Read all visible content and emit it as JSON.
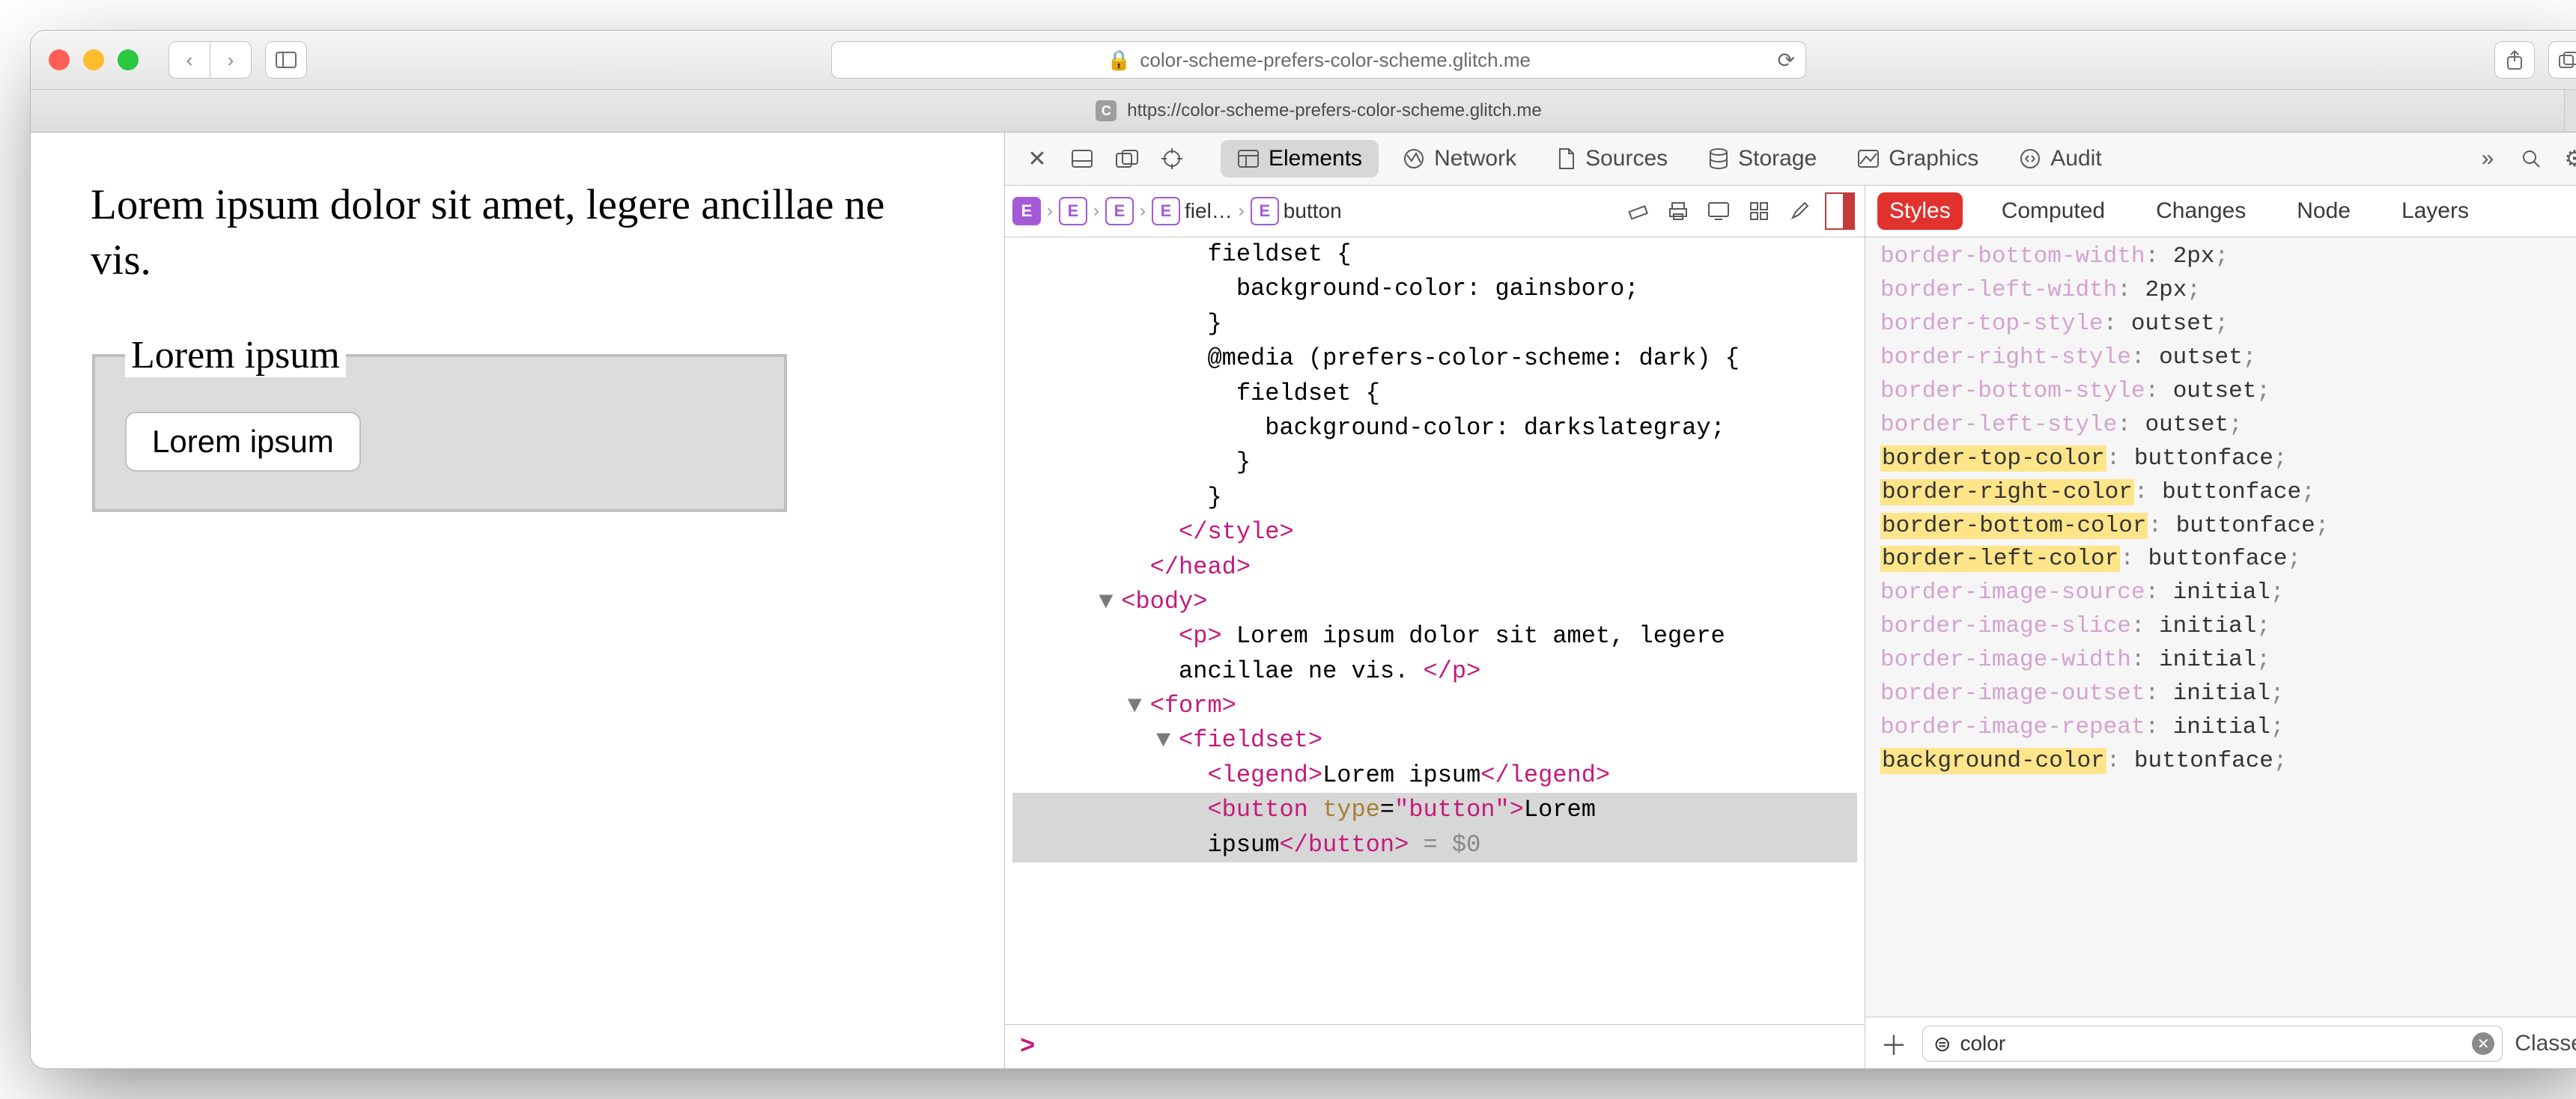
{
  "urlbar": "color-scheme-prefers-color-scheme.glitch.me",
  "tab_url": "https://color-scheme-prefers-color-scheme.glitch.me",
  "tab_icon_letter": "C",
  "page": {
    "paragraph": "Lorem ipsum dolor sit amet, legere ancillae ne vis.",
    "legend": "Lorem ipsum",
    "button": "Lorem ipsum"
  },
  "devtools": {
    "tabs": [
      "Elements",
      "Network",
      "Sources",
      "Storage",
      "Graphics",
      "Audit"
    ],
    "active_tab": "Elements",
    "breadcrumb_labels": [
      "",
      "",
      "",
      "fiel…",
      "button"
    ],
    "console_prompt": ">",
    "style_tabs": [
      "Styles",
      "Computed",
      "Changes",
      "Node",
      "Layers"
    ],
    "active_style_tab": "Styles",
    "filter_value": "color",
    "classes_label": "Classes",
    "dom_lines": [
      {
        "indent": 14,
        "html": "fieldset {"
      },
      {
        "indent": 16,
        "html": "background-color: gainsboro;"
      },
      {
        "indent": 14,
        "html": "}"
      },
      {
        "indent": 14,
        "html": "@media (prefers-color-scheme: dark) {"
      },
      {
        "indent": 16,
        "html": "fieldset {"
      },
      {
        "indent": 18,
        "html": "background-color: darkslategray;"
      },
      {
        "indent": 16,
        "html": "}"
      },
      {
        "indent": 14,
        "html": "}"
      },
      {
        "indent": 12,
        "html": "<span class='tag'>&lt;/style&gt;</span>"
      },
      {
        "indent": 10,
        "html": "<span class='tag'>&lt;/head&gt;</span>"
      },
      {
        "indent": 8,
        "tri": "▼",
        "html": "<span class='tag'>&lt;body&gt;</span>"
      },
      {
        "indent": 12,
        "html": "<span class='tag'>&lt;p&gt;</span> Lorem ipsum dolor sit amet, legere"
      },
      {
        "indent": 12,
        "html": "ancillae ne vis. <span class='tag'>&lt;/p&gt;</span>"
      },
      {
        "indent": 10,
        "tri": "▼",
        "html": "<span class='tag'>&lt;form&gt;</span>"
      },
      {
        "indent": 12,
        "tri": "▼",
        "html": "<span class='tag'>&lt;fieldset&gt;</span>"
      },
      {
        "indent": 14,
        "html": "<span class='tag'>&lt;legend&gt;</span>Lorem ipsum<span class='tag'>&lt;/legend&gt;</span>"
      },
      {
        "indent": 14,
        "sel": true,
        "html": "<span class='tag'>&lt;button</span> <span class='attr'>type</span>=<span class='str'>\"button\"</span><span class='tag'>&gt;</span>Lorem"
      },
      {
        "indent": 14,
        "sel": true,
        "html": "ipsum<span class='tag'>&lt;/button&gt;</span> <span style='color:#888'>= $0</span>"
      }
    ],
    "props": [
      {
        "name": "border-bottom-width",
        "value": "2px",
        "dim": true
      },
      {
        "name": "border-left-width",
        "value": "2px",
        "dim": true
      },
      {
        "name": "border-top-style",
        "value": "outset",
        "dim": true
      },
      {
        "name": "border-right-style",
        "value": "outset",
        "dim": true
      },
      {
        "name": "border-bottom-style",
        "value": "outset",
        "dim": true
      },
      {
        "name": "border-left-style",
        "value": "outset",
        "dim": true
      },
      {
        "name": "border-top-color",
        "value": "buttonface",
        "hl": true
      },
      {
        "name": "border-right-color",
        "value": "buttonface",
        "hl": true
      },
      {
        "name": "border-bottom-color",
        "value": "buttonface",
        "hl": true
      },
      {
        "name": "border-left-color",
        "value": "buttonface",
        "hl": true
      },
      {
        "name": "border-image-source",
        "value": "initial",
        "dim": true
      },
      {
        "name": "border-image-slice",
        "value": "initial",
        "dim": true
      },
      {
        "name": "border-image-width",
        "value": "initial",
        "dim": true
      },
      {
        "name": "border-image-outset",
        "value": "initial",
        "dim": true
      },
      {
        "name": "border-image-repeat",
        "value": "initial",
        "dim": true
      },
      {
        "name": "background-color",
        "value": "buttonface",
        "hl": true
      }
    ]
  }
}
